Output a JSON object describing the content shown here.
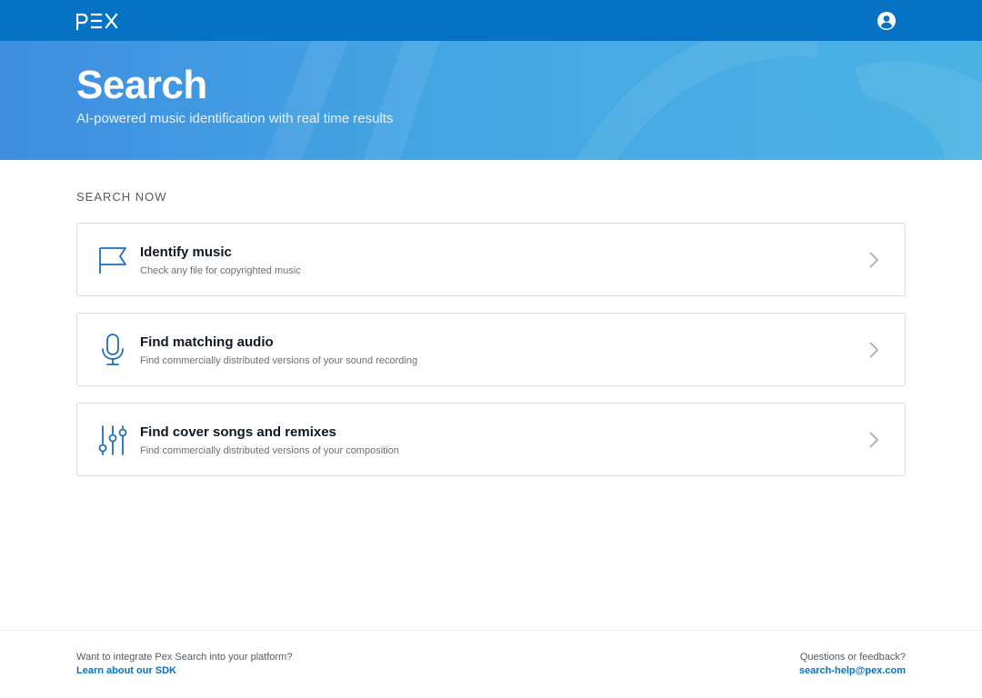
{
  "header": {
    "logo_icon": "pex-logo",
    "account_icon": "account-circle-icon",
    "bar_color": "#0672c4"
  },
  "hero": {
    "title": "Search",
    "subtitle": "AI-powered music identification with real time results"
  },
  "main": {
    "section_label": "SEARCH NOW",
    "cards": [
      {
        "icon": "flag-icon",
        "title": "Identify music",
        "description": "Check any file for copyrighted music"
      },
      {
        "icon": "microphone-icon",
        "title": "Find matching audio",
        "description": "Find commercially distributed versions of your sound recording"
      },
      {
        "icon": "sliders-icon",
        "title": "Find cover songs and remixes",
        "description": "Find commercially distributed versions of your composition"
      }
    ]
  },
  "footer": {
    "left_text": "Want to integrate Pex Search into your platform?",
    "left_link": "Learn about our SDK",
    "right_text": "Questions or feedback?",
    "right_link": "search-help@pex.com"
  },
  "colors": {
    "accent": "#0672c4",
    "icon": "#1d6fb8"
  }
}
